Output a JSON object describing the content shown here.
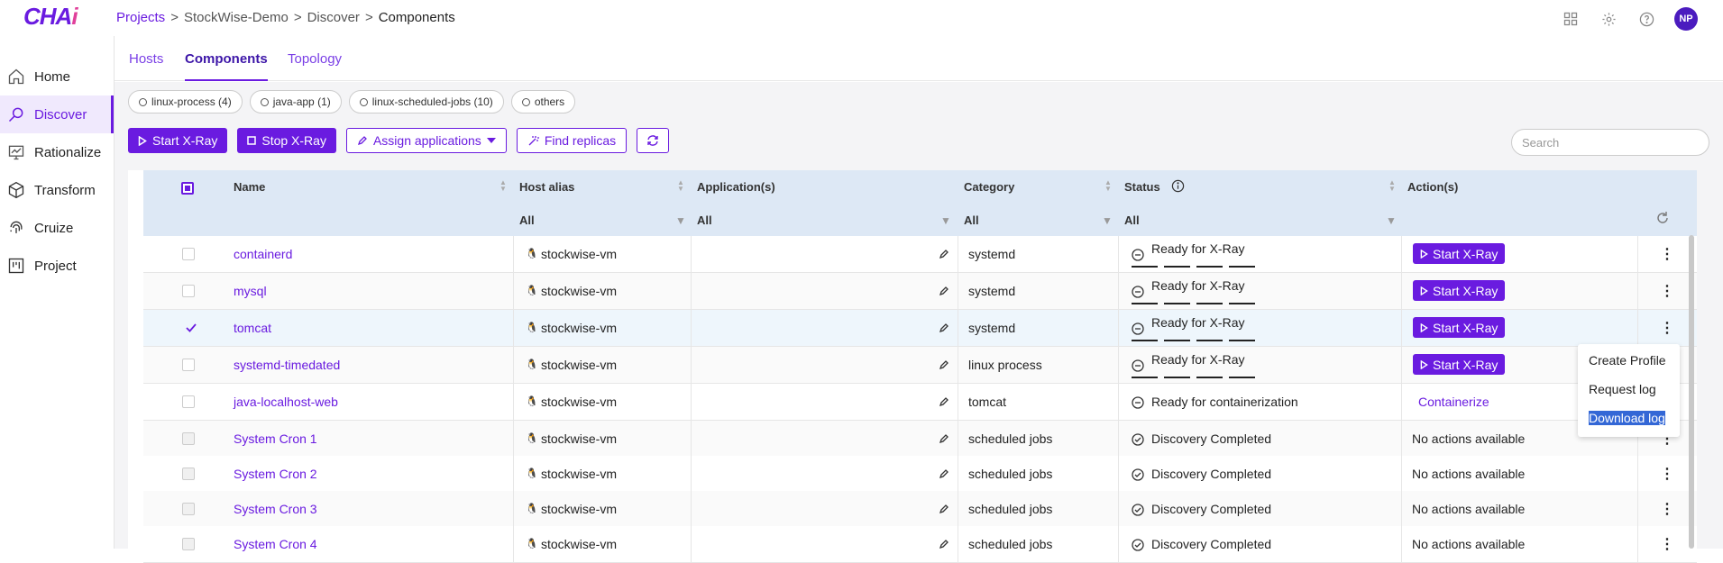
{
  "app": {
    "logo_prefix": "CHA",
    "logo_suffix": "i"
  },
  "breadcrumb": [
    "Projects",
    "StockWise-Demo",
    "Discover",
    "Components"
  ],
  "user": {
    "initials": "NP"
  },
  "sidebar": {
    "items": [
      {
        "label": "Home",
        "icon": "home-icon"
      },
      {
        "label": "Discover",
        "icon": "discover-icon",
        "active": true
      },
      {
        "label": "Rationalize",
        "icon": "rationalize-icon"
      },
      {
        "label": "Transform",
        "icon": "cube-icon"
      },
      {
        "label": "Cruize",
        "icon": "fingerprint-icon"
      },
      {
        "label": "Project",
        "icon": "project-icon"
      }
    ]
  },
  "tabs": [
    {
      "label": "Hosts"
    },
    {
      "label": "Components",
      "active": true
    },
    {
      "label": "Topology"
    }
  ],
  "chips": [
    "linux-process (4)",
    "java-app (1)",
    "linux-scheduled-jobs (10)",
    "others"
  ],
  "toolbar": {
    "start": "Start X-Ray",
    "stop": "Stop X-Ray",
    "assign": "Assign applications",
    "find": "Find replicas"
  },
  "search": {
    "placeholder": "Search"
  },
  "columns": {
    "name": "Name",
    "host": "Host alias",
    "apps": "Application(s)",
    "category": "Category",
    "status": "Status",
    "actions": "Action(s)"
  },
  "filters": {
    "host": "All",
    "apps": "All",
    "category": "All",
    "status": "All"
  },
  "rows": [
    {
      "name": "containerd",
      "host": "stockwise-vm",
      "category": "systemd",
      "status": "Ready for X-Ray",
      "action": "Start X-Ray"
    },
    {
      "name": "mysql",
      "host": "stockwise-vm",
      "category": "systemd",
      "status": "Ready for X-Ray",
      "action": "Start X-Ray"
    },
    {
      "name": "tomcat",
      "host": "stockwise-vm",
      "category": "systemd",
      "status": "Ready for X-Ray",
      "action": "Start X-Ray",
      "checked": true
    },
    {
      "name": "systemd-timedated",
      "host": "stockwise-vm",
      "category": "linux process",
      "status": "Ready for X-Ray",
      "action": "Start X-Ray"
    },
    {
      "name": "java-localhost-web",
      "host": "stockwise-vm",
      "category": "tomcat",
      "status": "Ready for containerization",
      "action": "Containerize"
    },
    {
      "name": "System Cron 1",
      "host": "stockwise-vm",
      "category": "scheduled jobs",
      "status": "Discovery Completed",
      "action": "No actions available"
    },
    {
      "name": "System Cron 2",
      "host": "stockwise-vm",
      "category": "scheduled jobs",
      "status": "Discovery Completed",
      "action": "No actions available"
    },
    {
      "name": "System Cron 3",
      "host": "stockwise-vm",
      "category": "scheduled jobs",
      "status": "Discovery Completed",
      "action": "No actions available"
    },
    {
      "name": "System Cron 4",
      "host": "stockwise-vm",
      "category": "scheduled jobs",
      "status": "Discovery Completed",
      "action": "No actions available"
    }
  ],
  "context_menu": [
    "Create Profile",
    "Request log",
    "Download log"
  ],
  "colors": {
    "accent": "#6a1be0",
    "header_bg": "#dde8f5",
    "selected_row": "#eef6fc"
  }
}
